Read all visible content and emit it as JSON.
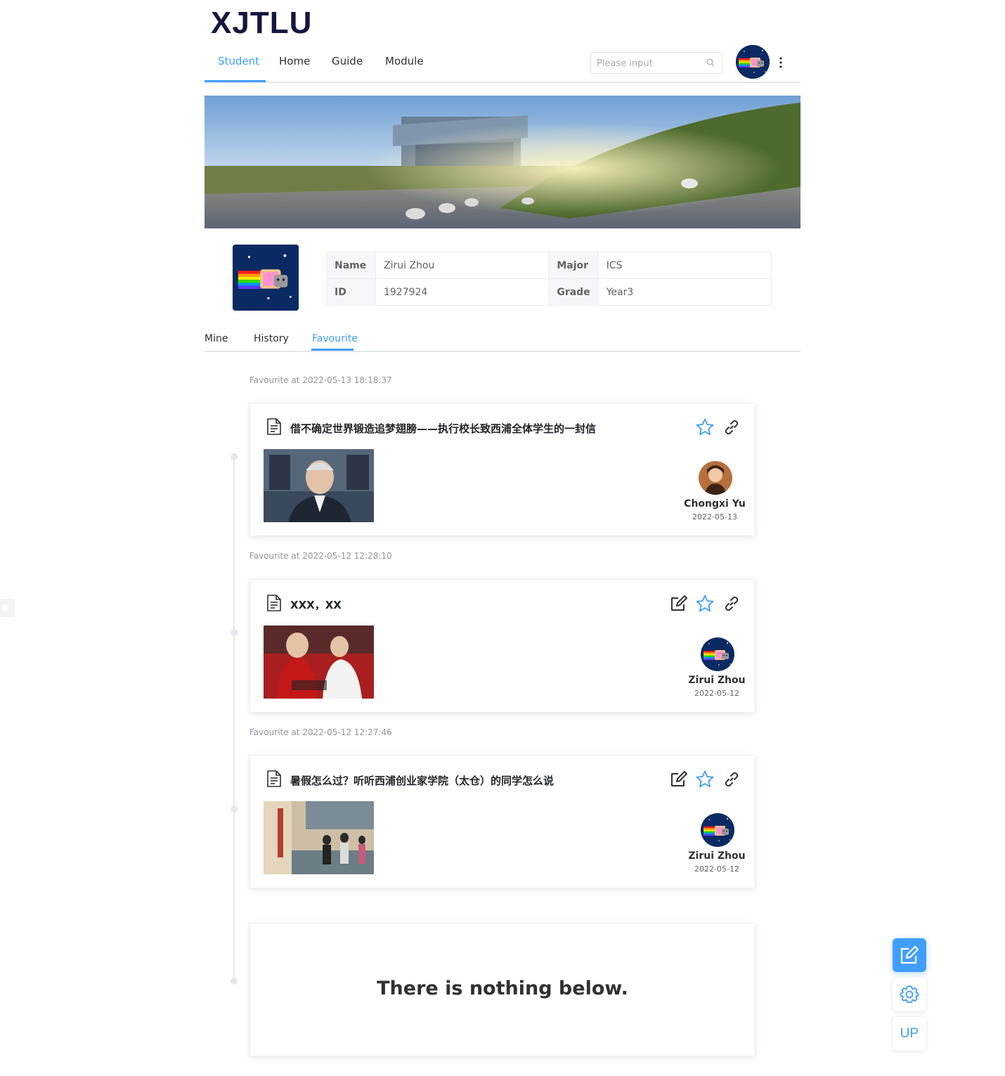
{
  "app": {
    "logo_text": "XJTLU"
  },
  "nav": {
    "tabs": [
      {
        "label": "Student"
      },
      {
        "label": "Home"
      },
      {
        "label": "Guide"
      },
      {
        "label": "Module"
      }
    ],
    "active_tab": "Student",
    "search": {
      "placeholder": "Please input",
      "value": ""
    }
  },
  "profile": {
    "name_label": "Name",
    "name": "Zirui Zhou",
    "major_label": "Major",
    "major": "ICS",
    "id_label": "ID",
    "id": "1927924",
    "grade_label": "Grade",
    "grade": "Year3"
  },
  "subtabs": {
    "items": [
      {
        "label": "Mine"
      },
      {
        "label": "History"
      },
      {
        "label": "Favourite"
      }
    ],
    "active": "Favourite"
  },
  "favourites": [
    {
      "fav_time": "Favourite at 2022-05-13 18:18:37",
      "title": "借不确定世界锻造追梦翅膀——执行校长致西浦全体学生的一封信",
      "author": "Chongxi Yu",
      "date": "2022-05-13",
      "editable": false
    },
    {
      "fav_time": "Favourite at 2022-05-12 12:28:10",
      "title": "XXX，XX",
      "author": "Zirui Zhou",
      "date": "2022-05-12",
      "editable": true
    },
    {
      "fav_time": "Favourite at 2022-05-12 12:27:46",
      "title": "暑假怎么过？听听西浦创业家学院（太仓）的同学怎么说",
      "author": "Zirui Zhou",
      "date": "2022-05-12",
      "editable": true
    }
  ],
  "end_message": "There is nothing below.",
  "floating": {
    "up_label": "UP"
  },
  "icons": {
    "search": "search-icon",
    "more": "more-vertical-icon",
    "document": "document-icon",
    "edit": "edit-icon",
    "star": "star-icon",
    "link": "link-icon",
    "gear": "gear-icon"
  },
  "colors": {
    "accent": "#409eff",
    "logo": "#14163f",
    "avatar_bg": "#0b2a63"
  }
}
